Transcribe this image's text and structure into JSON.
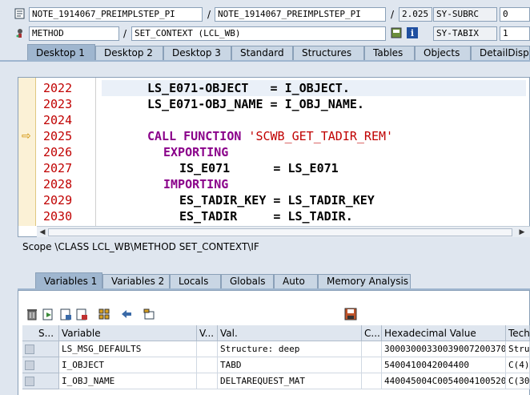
{
  "header": {
    "program1": "NOTE_1914067_PREIMPLSTEP_PI",
    "program2": "NOTE_1914067_PREIMPLSTEP_PI",
    "line_no": "2.025",
    "sysfield1_name": "SY-SUBRC",
    "sysfield1_value": "0",
    "type": "METHOD",
    "event": "SET_CONTEXT (LCL_WB)",
    "sysfield2_name": "SY-TABIX",
    "sysfield2_value": "1",
    "sep1": "/",
    "sep2": "/",
    "sep3": "/"
  },
  "desktop_tabs": [
    "Desktop 1",
    "Desktop 2",
    "Desktop 3",
    "Standard",
    "Structures",
    "Tables",
    "Objects",
    "DetailDisplay"
  ],
  "code": {
    "line_numbers": [
      "2022",
      "2023",
      "2024",
      "2025",
      "2026",
      "2027",
      "2028",
      "2029",
      "2030"
    ],
    "lines": [
      [
        "LS_E071-OBJECT   = I_OBJECT."
      ],
      [
        "LS_E071-OBJ_NAME = I_OBJ_NAME."
      ],
      [
        ""
      ],
      [
        "CALL FUNCTION",
        " 'SCWB_GET_TADIR_REM'"
      ],
      [
        "EXPORTING"
      ],
      [
        "IS_E071      = LS_E071"
      ],
      [
        "IMPORTING"
      ],
      [
        "ES_TADIR_KEY = LS_TADIR_KEY"
      ],
      [
        "ES_TADIR     = LS_TADIR."
      ]
    ],
    "current_line_marker": "⇨"
  },
  "scope": "Scope \\CLASS LCL_WB\\METHOD SET_CONTEXT\\IF",
  "variable_tabs": [
    "Variables 1",
    "Variables 2",
    "Locals",
    "Globals",
    "Auto",
    "Memory Analysis"
  ],
  "toolbar_icons": [
    "delete-icon",
    "import-icon",
    "save-list-icon",
    "delete-list-icon",
    "structure-icon",
    "navigate-icon",
    "watch-icon"
  ],
  "table": {
    "headers": [
      "S...",
      "Variable",
      "V...",
      "Val.",
      "C...",
      "Hexadecimal Value",
      "Techn"
    ],
    "rows": [
      [
        "LS_MSG_DEFAULTS",
        "Structure: deep",
        "3000300033003900720037003700...",
        "Structu"
      ],
      [
        "I_OBJECT",
        "TABD",
        "5400410042004400",
        "C(4)"
      ],
      [
        "I_OBJ_NAME",
        "DELTAREQUEST_MAT",
        "440045004C00540041005200450...",
        "C(30)"
      ]
    ]
  },
  "colors": {
    "background": "#dfe6ef",
    "line_number": "#c00000",
    "keyword": "#8a008a",
    "string": "#c00000"
  }
}
